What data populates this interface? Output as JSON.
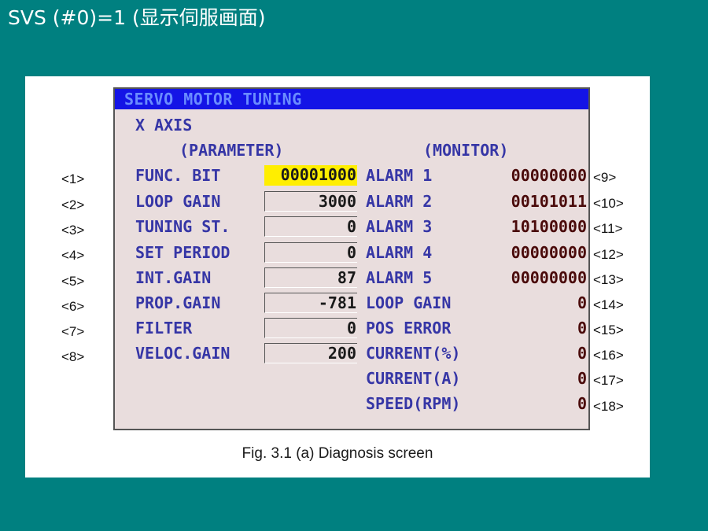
{
  "slide": {
    "title": "SVS (#0)=1 (显示伺服画面)"
  },
  "screen": {
    "window_title": "SERVO MOTOR TUNING",
    "axis_label": "X AXIS",
    "parameter_header": "(PARAMETER)",
    "monitor_header": "(MONITOR)",
    "parameters": [
      {
        "label": "FUNC. BIT",
        "value": "00001000"
      },
      {
        "label": "LOOP GAIN",
        "value": "3000"
      },
      {
        "label": "TUNING ST.",
        "value": "0"
      },
      {
        "label": "SET PERIOD",
        "value": "0"
      },
      {
        "label": "INT.GAIN",
        "value": "87"
      },
      {
        "label": "PROP.GAIN",
        "value": "-781"
      },
      {
        "label": "FILTER",
        "value": "0"
      },
      {
        "label": "VELOC.GAIN",
        "value": "200"
      }
    ],
    "monitor": [
      {
        "label": "ALARM 1",
        "value": "00000000"
      },
      {
        "label": "ALARM 2",
        "value": "00101011"
      },
      {
        "label": "ALARM 3",
        "value": "10100000"
      },
      {
        "label": "ALARM 4",
        "value": "00000000"
      },
      {
        "label": "ALARM 5",
        "value": "00000000"
      },
      {
        "label": "LOOP GAIN",
        "value": "0"
      },
      {
        "label": "POS ERROR",
        "value": "0"
      },
      {
        "label": "CURRENT(%)",
        "value": "0"
      },
      {
        "label": "CURRENT(A)",
        "value": "0"
      },
      {
        "label": "SPEED(RPM)",
        "value": "0"
      }
    ]
  },
  "row_numbers_left": [
    "<1>",
    "<2>",
    "<3>",
    "<4>",
    "<5>",
    "<6>",
    "<7>",
    "<8>"
  ],
  "row_numbers_right": [
    "<9>",
    "<10>",
    "<11>",
    "<12>",
    "<13>",
    "<14>",
    "<15>",
    "<16>",
    "<17>",
    "<18>"
  ],
  "caption": "Fig. 3.1 (a)  Diagnosis screen",
  "colors": {
    "slide_background": "#008080",
    "titlebar": "#1414e6",
    "screen_background": "#e9dddd",
    "highlight": "#ffee00",
    "label_text": "#3636a6"
  }
}
